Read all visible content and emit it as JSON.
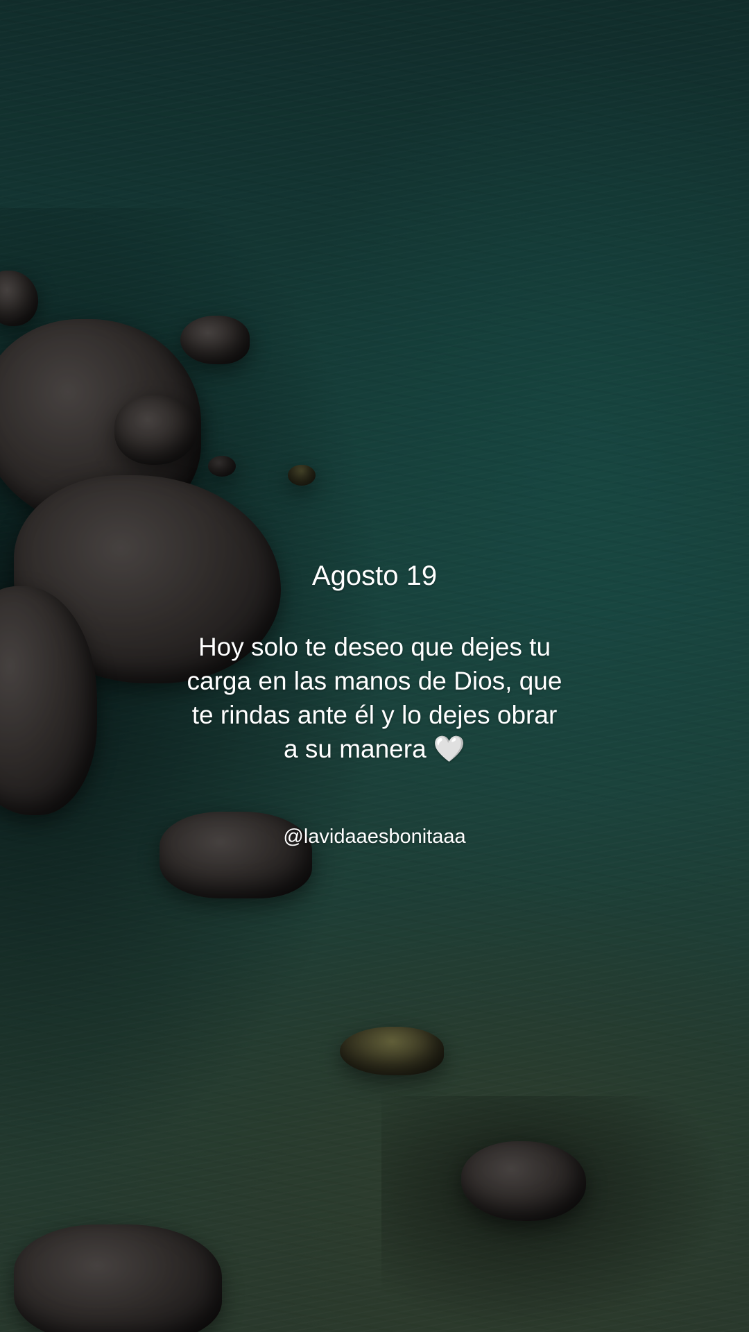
{
  "post": {
    "date": "Agosto 19",
    "message_lines": [
      "Hoy solo te deseo que dejes tu",
      "carga en las manos de Dios, que",
      "te rindas ante él y lo dejes obrar",
      "a su manera 🤍"
    ],
    "handle": "@lavidaaesbonitaaa"
  },
  "background": {
    "subject": "sea-with-rocks",
    "colors": {
      "water_deep": "#173a38",
      "water_mid": "#1f534c",
      "water_shallow": "#34493a",
      "rock": "#3b3634",
      "text": "#ffffff"
    }
  }
}
